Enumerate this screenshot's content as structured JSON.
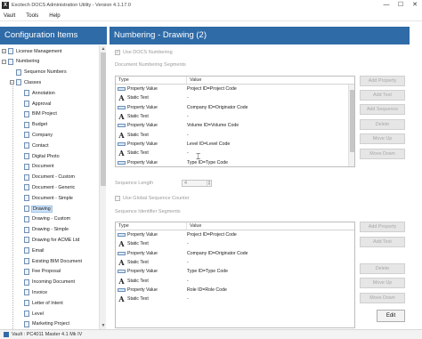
{
  "window": {
    "title": "Excitech DOCS Administration Utility - Version 4.1.17.0",
    "app_icon": "X",
    "controls": [
      "—",
      "☐",
      "✕"
    ]
  },
  "menu": [
    "Vault",
    "Tools",
    "Help"
  ],
  "left": {
    "header": "Configuration Items",
    "tree": [
      {
        "label": "License Management",
        "expander": "+"
      },
      {
        "label": "Numbering",
        "expander": "−"
      },
      {
        "label": "Sequence Numbers"
      },
      {
        "label": "Classes",
        "expander": "−"
      },
      {
        "label": "Annotation"
      },
      {
        "label": "Approval"
      },
      {
        "label": "BIM Project"
      },
      {
        "label": "Budget"
      },
      {
        "label": "Company"
      },
      {
        "label": "Contact"
      },
      {
        "label": "Digital Photo"
      },
      {
        "label": "Document"
      },
      {
        "label": "Document - Custom"
      },
      {
        "label": "Document - Generic"
      },
      {
        "label": "Document - Simple"
      },
      {
        "label": "Drawing",
        "selected": true
      },
      {
        "label": "Drawing - Custom"
      },
      {
        "label": "Drawing - Simple"
      },
      {
        "label": "Drawing for ACME Ltd"
      },
      {
        "label": "Email"
      },
      {
        "label": "Existing BIM Document"
      },
      {
        "label": "Fee Proposal"
      },
      {
        "label": "Incoming Document"
      },
      {
        "label": "Invoice"
      },
      {
        "label": "Letter of Intent"
      },
      {
        "label": "Level"
      },
      {
        "label": "Marketing Project"
      }
    ]
  },
  "right": {
    "header": "Numbering - Drawing (2)",
    "use_docs_numbering": "Use DOCS Numbering",
    "doc_segments_label": "Document Numbering Segments",
    "columns": {
      "type": "Type",
      "value": "Value"
    },
    "doc_segments": [
      {
        "type": "Property Value",
        "icon": "property",
        "value": "Project ID=Project Code"
      },
      {
        "type": "Static Text",
        "icon": "text",
        "value": "-"
      },
      {
        "type": "Property Value",
        "icon": "property",
        "value": "Company ID=Originator Code"
      },
      {
        "type": "Static Text",
        "icon": "text",
        "value": "-"
      },
      {
        "type": "Property Value",
        "icon": "property",
        "value": "Volume ID=Volume Code"
      },
      {
        "type": "Static Text",
        "icon": "text",
        "value": "-"
      },
      {
        "type": "Property Value",
        "icon": "property",
        "value": "Level ID=Level Code"
      },
      {
        "type": "Static Text",
        "icon": "text",
        "value": "-"
      },
      {
        "type": "Property Value",
        "icon": "property",
        "value": "Type ID=Type Code"
      }
    ],
    "doc_buttons": [
      "Add Property",
      "Add Text",
      "Add Sequence",
      "Delete",
      "Move Up",
      "Move Down"
    ],
    "sequence_length_label": "Sequence Length",
    "sequence_length_value": "4",
    "use_global_counter": "Use Global Sequence Counter",
    "seq_segments_label": "Sequence Identifier Segments",
    "seq_segments": [
      {
        "type": "Property Value",
        "icon": "property",
        "value": "Project ID=Project Code"
      },
      {
        "type": "Static Text",
        "icon": "text",
        "value": "-"
      },
      {
        "type": "Property Value",
        "icon": "property",
        "value": "Company ID=Originator Code"
      },
      {
        "type": "Static Text",
        "icon": "text",
        "value": "-"
      },
      {
        "type": "Property Value",
        "icon": "property",
        "value": "Type ID=Type Code"
      },
      {
        "type": "Static Text",
        "icon": "text",
        "value": "-"
      },
      {
        "type": "Property Value",
        "icon": "property",
        "value": "Role ID=Role Code"
      },
      {
        "type": "Static Text",
        "icon": "text",
        "value": "-"
      }
    ],
    "seq_buttons": [
      "Add Property",
      "Add Text",
      "Delete",
      "Move Up",
      "Move Down"
    ],
    "edit_button": "Edit"
  },
  "status": {
    "text": "Vault : PC4011 Master 4.1 Mk IV"
  },
  "colors": {
    "header_blue": "#2f6ba7",
    "disabled_text": "#a8a8a8"
  }
}
